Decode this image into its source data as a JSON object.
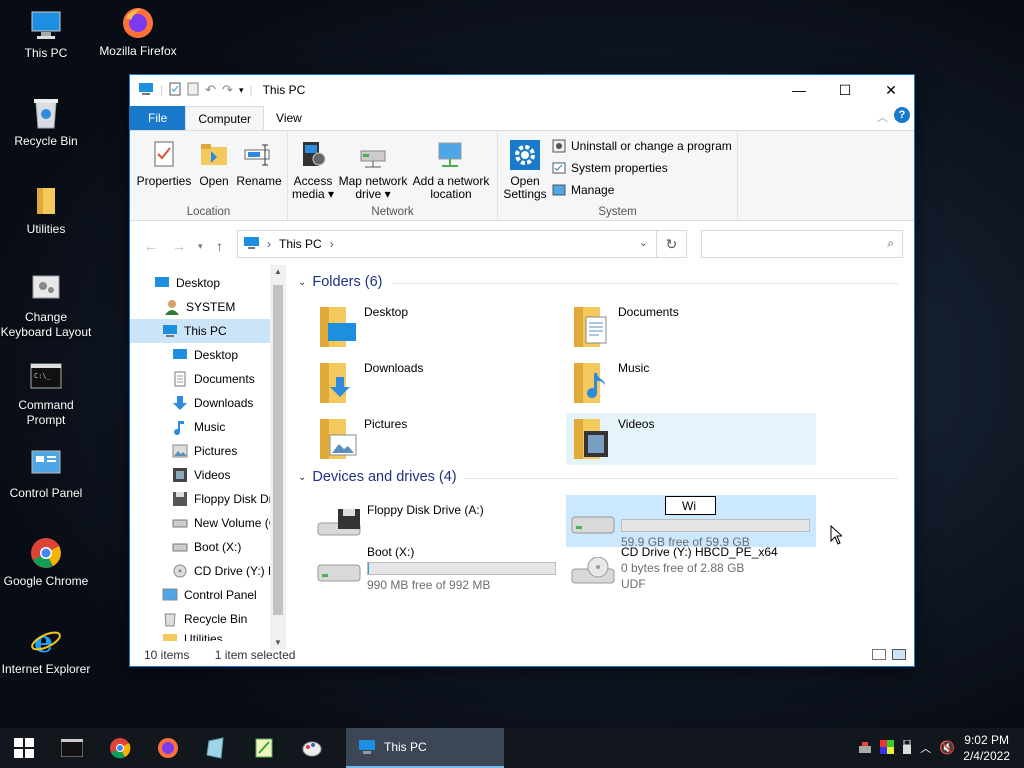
{
  "desktop": {
    "icons": [
      {
        "label": "This PC"
      },
      {
        "label": "Mozilla Firefox"
      },
      {
        "label": "Recycle Bin"
      },
      {
        "label": "Utilities"
      },
      {
        "label": "Change Keyboard Layout"
      },
      {
        "label": "Command Prompt"
      },
      {
        "label": "Control Panel"
      },
      {
        "label": "Google Chrome"
      },
      {
        "label": "Internet Explorer"
      }
    ]
  },
  "window": {
    "title": "This PC",
    "tabs": {
      "file": "File",
      "computer": "Computer",
      "view": "View"
    },
    "ribbon": {
      "location": {
        "name": "Location",
        "properties": "Properties",
        "open": "Open",
        "rename": "Rename"
      },
      "network": {
        "name": "Network",
        "access_media": "Access media ▾",
        "map_drive": "Map network drive ▾",
        "add_location": "Add a network location"
      },
      "system": {
        "name": "System",
        "open_settings": "Open Settings",
        "uninstall": "Uninstall or change a program",
        "sys_props": "System properties",
        "manage": "Manage"
      }
    },
    "address": {
      "path": "This PC",
      "search_placeholder": ""
    },
    "nav": [
      {
        "label": "Desktop"
      },
      {
        "label": "SYSTEM"
      },
      {
        "label": "This PC"
      },
      {
        "label": "Desktop"
      },
      {
        "label": "Documents"
      },
      {
        "label": "Downloads"
      },
      {
        "label": "Music"
      },
      {
        "label": "Pictures"
      },
      {
        "label": "Videos"
      },
      {
        "label": "Floppy Disk Dri"
      },
      {
        "label": "New Volume (C"
      },
      {
        "label": "Boot (X:)"
      },
      {
        "label": "CD Drive (Y:) H"
      },
      {
        "label": "Control Panel"
      },
      {
        "label": "Recycle Bin"
      },
      {
        "label": "Utilities"
      }
    ],
    "folders_header": "Folders (6)",
    "folders": [
      {
        "name": "Desktop"
      },
      {
        "name": "Documents"
      },
      {
        "name": "Downloads"
      },
      {
        "name": "Music"
      },
      {
        "name": "Pictures"
      },
      {
        "name": "Videos"
      }
    ],
    "drives_header": "Devices and drives (4)",
    "drives": [
      {
        "name": "Floppy Disk Drive (A:)",
        "free": ""
      },
      {
        "name": "Wi",
        "free": "59.9 GB free of 59.9 GB",
        "used_fraction": 0.0
      },
      {
        "name": "Boot (X:)",
        "free": "990 MB free of 992 MB",
        "used_fraction": 0.002
      },
      {
        "name": "CD Drive (Y:) HBCD_PE_x64",
        "free": "0 bytes free of 2.88 GB",
        "fs": "UDF"
      }
    ],
    "status": {
      "items": "10 items",
      "selected": "1 item selected"
    }
  },
  "taskbar": {
    "active_label": "This PC",
    "time": "9:02 PM",
    "date": "2/4/2022"
  }
}
